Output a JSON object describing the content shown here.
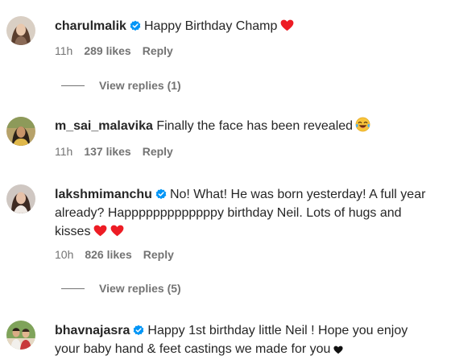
{
  "comments": [
    {
      "username": "charulmalik",
      "verified": true,
      "text": "Happy Birthday Champ",
      "time": "11h",
      "likes": "289 likes",
      "reply": "Reply",
      "view_replies": "View replies (1)"
    },
    {
      "username": "m_sai_malavika",
      "verified": false,
      "text": "Finally the face has been revealed",
      "time": "11h",
      "likes": "137 likes",
      "reply": "Reply"
    },
    {
      "username": "lakshmimanchu",
      "verified": true,
      "text": "No! What! He was born yesterday! A full year already? Happpppppppppppy birthday Neil. Lots of hugs and kisses",
      "time": "10h",
      "likes": "826 likes",
      "reply": "Reply",
      "view_replies": "View replies (5)"
    },
    {
      "username": "bhavnajasra",
      "verified": true,
      "text": "Happy 1st birthday little Neil ! Hope you enjoy your baby hand & feet castings we made for you"
    }
  ],
  "colors": {
    "verified_badge": "#0095f6",
    "heart": "#ed1c24",
    "meta_text": "#737373",
    "main_text": "#262626"
  },
  "icons": {
    "verified": "verified-badge-icon",
    "heart": "red-heart-icon",
    "laugh": "tears-of-joy-emoji-icon",
    "black_heart": "black-heart-icon"
  }
}
